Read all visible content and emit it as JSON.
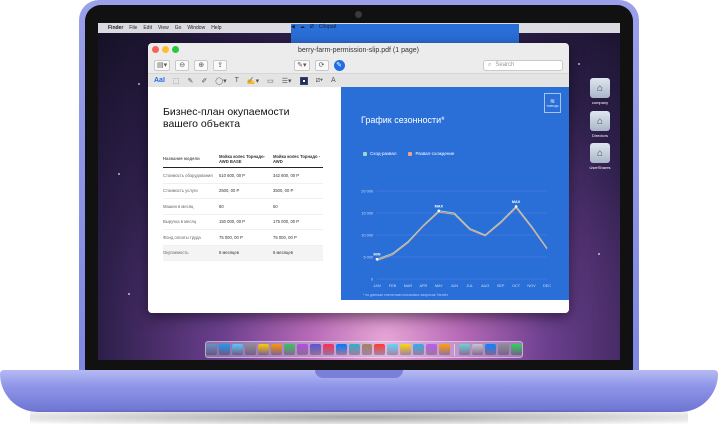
{
  "menubar": {
    "apple": "",
    "items": [
      "Finder",
      "File",
      "Edit",
      "View",
      "Go",
      "Window",
      "Help"
    ],
    "right_items": [
      "◀",
      "☁",
      "Ø",
      "Сборай"
    ]
  },
  "window": {
    "title": "berry-farm-permission-slip.pdf (1 page)",
    "search_placeholder": "Search",
    "markup_aa": "AaI",
    "markup_text_tool": "A"
  },
  "document": {
    "title": "Бизнес-план окупаемости вашего объекта",
    "table": {
      "headers": [
        "Название модели",
        "Мойка колес Торнадо-AWD BASE",
        "Мойка колес Торнадо -AWD"
      ],
      "rows": [
        [
          "Стоимость оборудования",
          "510 600, 00 Р",
          "342 800, 00 Р"
        ],
        [
          "Стоимость услуги",
          "2500, 00 Р",
          "3500, 00 Р"
        ],
        [
          "Машин в месяц",
          "80",
          "50"
        ],
        [
          "Выручка в месяц",
          "150 000, 00 Р",
          "175 000, 00 Р"
        ],
        [
          "Фонд оплаты труда",
          "75 000, 00 Р",
          "75 000, 00 Р"
        ],
        [
          "Окупаемость",
          "6 месяцев",
          "6 месяцев"
        ]
      ]
    }
  },
  "chart_panel": {
    "badge_top": "≋",
    "badge_bottom": "ТОРНАДО",
    "title": "График сезонности*",
    "footnote": "* по данным статистики поисковых запросов Yandex"
  },
  "chart_data": {
    "type": "line",
    "title": "График сезонности*",
    "x": [
      "JAN",
      "FEB",
      "MAR",
      "APR",
      "MAY",
      "JUN",
      "JUL",
      "AUG",
      "SEP",
      "OCT",
      "NOV",
      "DEC"
    ],
    "yticks": [
      0,
      5000,
      10000,
      15000,
      20000
    ],
    "ytick_labels": [
      "0",
      "5 000",
      "10 000",
      "15 000",
      "20 000"
    ],
    "ylim": [
      0,
      20000
    ],
    "series": [
      {
        "name": "Сход-развал",
        "color": "#9ad9c8",
        "values": [
          4500,
          5800,
          8500,
          12200,
          15500,
          15000,
          11500,
          10000,
          13000,
          16500,
          12000,
          7000
        ]
      },
      {
        "name": "Развал-схождение",
        "color": "#e9a58e",
        "values": [
          4200,
          5500,
          8200,
          12000,
          15200,
          14700,
          11200,
          9800,
          12700,
          16200,
          11700,
          6800
        ]
      }
    ],
    "annotations": [
      {
        "label": "MIN",
        "x": "JAN"
      },
      {
        "label": "MAX",
        "x": "MAY"
      },
      {
        "label": "MAX",
        "x": "OCT"
      }
    ],
    "grid": true,
    "legend": "top-left"
  },
  "desktop": {
    "icons": [
      "company",
      "Directors",
      "UserShares"
    ]
  },
  "dock": {
    "colors": [
      "#6b8fc4",
      "#1d9bf0",
      "#5ac8fa",
      "#8e8e93",
      "#ffcc00",
      "#ff9500",
      "#34c759",
      "#af52de",
      "#5856d6",
      "#ff2d55",
      "#007aff",
      "#30b0c7",
      "#a2845e",
      "#ff3b30",
      "#64d2ff",
      "#ffd60a",
      "#32ade6",
      "#bf5af2",
      "#ff9f0a",
      "#66d4cf",
      "#c7c7cc",
      "#0a84ff",
      "#8e8e93",
      "#30d158"
    ]
  }
}
